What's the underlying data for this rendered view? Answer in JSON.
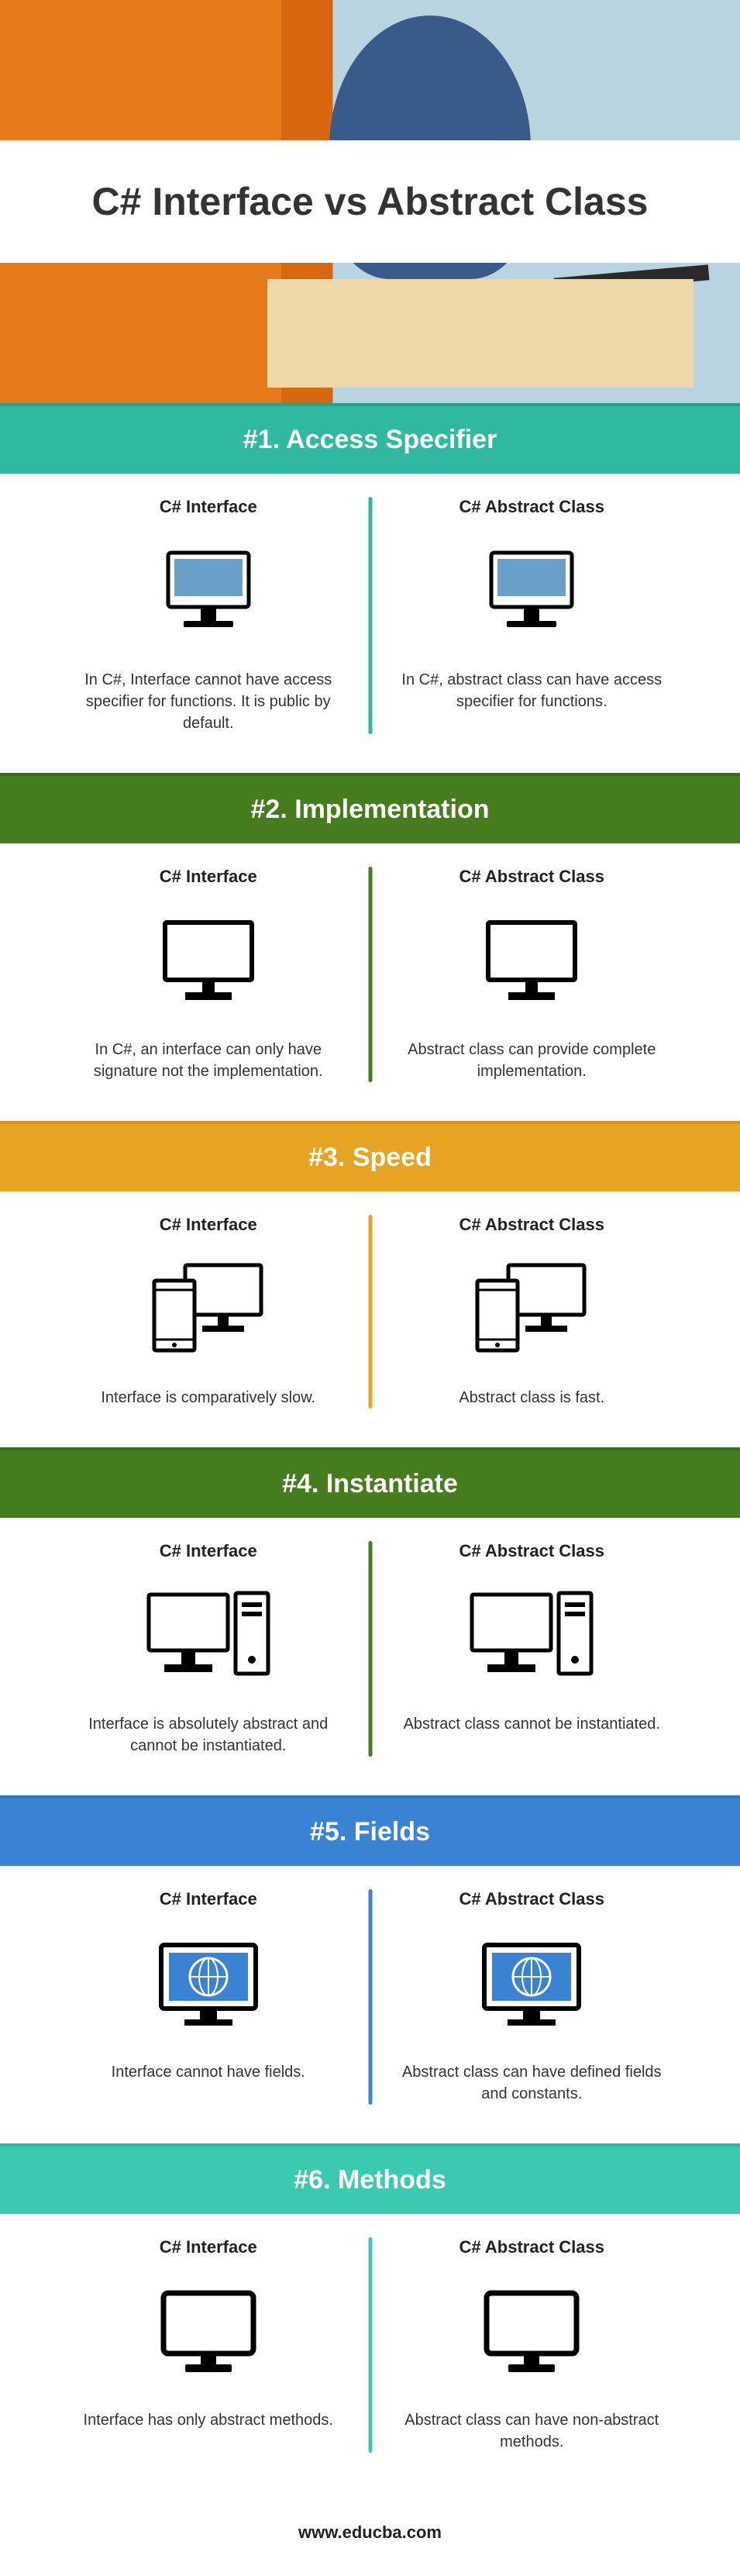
{
  "page_title": "C# Interface vs Abstract Class",
  "footer_url": "www.educba.com",
  "column_left_label": "C# Interface",
  "column_right_label": "C# Abstract Class",
  "sections": [
    {
      "header": "#1. Access Specifier",
      "header_class": "sh-teal",
      "divider_class": "cmp-teal",
      "icon": "imac",
      "left_desc": "In C#, Interface cannot have access specifier for functions. It is public by default.",
      "right_desc": "In C#, abstract class can have access specifier for functions."
    },
    {
      "header": "#2. Implementation",
      "header_class": "sh-green",
      "divider_class": "cmp-green",
      "icon": "monitor",
      "left_desc": "In C#, an interface can only have signature not the implementation.",
      "right_desc": "Abstract class can provide complete implementation."
    },
    {
      "header": "#3. Speed",
      "header_class": "sh-orange",
      "divider_class": "cmp-orange",
      "icon": "devices",
      "left_desc": "Interface is comparatively slow.",
      "right_desc": "Abstract class is fast."
    },
    {
      "header": "#4. Instantiate",
      "header_class": "sh-green",
      "divider_class": "cmp-green",
      "icon": "pc-tower",
      "left_desc": "Interface is absolutely abstract and cannot be instantiated.",
      "right_desc": "Abstract class cannot be instantiated."
    },
    {
      "header": "#5. Fields",
      "header_class": "sh-blue",
      "divider_class": "cmp-blue",
      "icon": "globe-screen",
      "left_desc": "Interface cannot have fields.",
      "right_desc": "Abstract class can have defined fields and constants."
    },
    {
      "header": "#6. Methods",
      "header_class": "sh-mint",
      "divider_class": "cmp-mint",
      "icon": "blank-monitor",
      "left_desc": "Interface has only abstract methods.",
      "right_desc": "Abstract class can have non-abstract methods."
    }
  ]
}
